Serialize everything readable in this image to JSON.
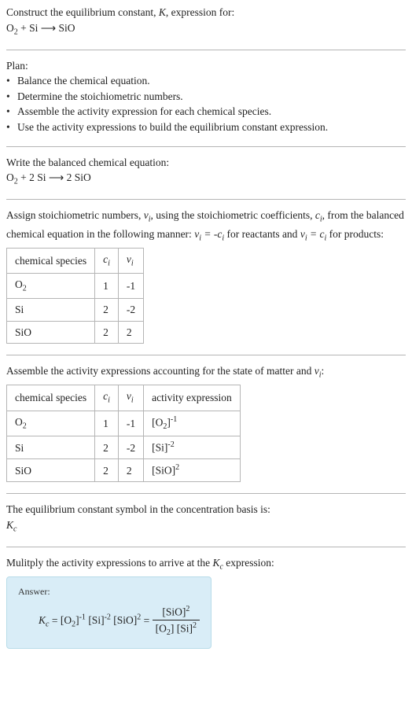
{
  "prompt": {
    "line1_a": "Construct the equilibrium constant, ",
    "line1_b": ", expression for:",
    "eq_lhs1": "O",
    "eq_sub1": "2",
    "eq_plus": " + Si ",
    "eq_arrow": "⟶",
    "eq_rhs": " SiO"
  },
  "plan": {
    "title": "Plan:",
    "b1": "Balance the chemical equation.",
    "b2": "Determine the stoichiometric numbers.",
    "b3": "Assemble the activity expression for each chemical species.",
    "b4": "Use the activity expressions to build the equilibrium constant expression."
  },
  "balanced": {
    "title": "Write the balanced chemical equation:",
    "lhs": "O",
    "lhs_sub": "2",
    "mid": " + 2 Si ",
    "arrow": "⟶",
    "rhs": " 2 SiO"
  },
  "stoich": {
    "intro_a": "Assign stoichiometric numbers, ",
    "intro_b": ", using the stoichiometric coefficients, ",
    "intro_c": ", from the balanced chemical equation in the following manner: ",
    "intro_d": " for reactants and ",
    "intro_e": " for products:",
    "head_species": "chemical species",
    "head_ci": "c",
    "head_vi": "ν",
    "i_sub": "i",
    "rows": [
      {
        "species_a": "O",
        "species_sub": "2",
        "species_b": "",
        "ci": "1",
        "vi": "-1"
      },
      {
        "species_a": "Si",
        "species_sub": "",
        "species_b": "",
        "ci": "2",
        "vi": "-2"
      },
      {
        "species_a": "SiO",
        "species_sub": "",
        "species_b": "",
        "ci": "2",
        "vi": "2"
      }
    ],
    "rel_reac_a": "ν",
    "rel_reac_b": " = -c",
    "rel_prod_a": "ν",
    "rel_prod_b": " = c"
  },
  "activity": {
    "intro_a": "Assemble the activity expressions accounting for the state of matter and ",
    "intro_b": ":",
    "head_species": "chemical species",
    "head_ci": "c",
    "head_vi": "ν",
    "head_act": "activity expression",
    "i_sub": "i",
    "rows": [
      {
        "sp_a": "O",
        "sp_sub": "2",
        "ci": "1",
        "vi": "-1",
        "act_base": "[O",
        "act_sub": "2",
        "act_close": "]",
        "act_exp": "-1"
      },
      {
        "sp_a": "Si",
        "sp_sub": "",
        "ci": "2",
        "vi": "-2",
        "act_base": "[Si",
        "act_sub": "",
        "act_close": "]",
        "act_exp": "-2"
      },
      {
        "sp_a": "SiO",
        "sp_sub": "",
        "ci": "2",
        "vi": "2",
        "act_base": "[SiO",
        "act_sub": "",
        "act_close": "]",
        "act_exp": "2"
      }
    ]
  },
  "symbol": {
    "line": "The equilibrium constant symbol in the concentration basis is:",
    "K": "K",
    "c": "c"
  },
  "multiply": {
    "line_a": "Mulitply the activity expressions to arrive at the ",
    "line_b": " expression:"
  },
  "answer": {
    "label": "Answer:",
    "K": "K",
    "c": "c",
    "eq": " = ",
    "t1_base": "[O",
    "t1_sub": "2",
    "t1_close": "]",
    "t1_exp": "-1",
    "t2_base": "[Si]",
    "t2_exp": "-2",
    "t3_base": "[SiO]",
    "t3_exp": "2",
    "eq2": " = ",
    "num_base": "[SiO]",
    "num_exp": "2",
    "den1_base": "[O",
    "den1_sub": "2",
    "den1_close": "] ",
    "den2_base": "[Si]",
    "den2_exp": "2"
  }
}
